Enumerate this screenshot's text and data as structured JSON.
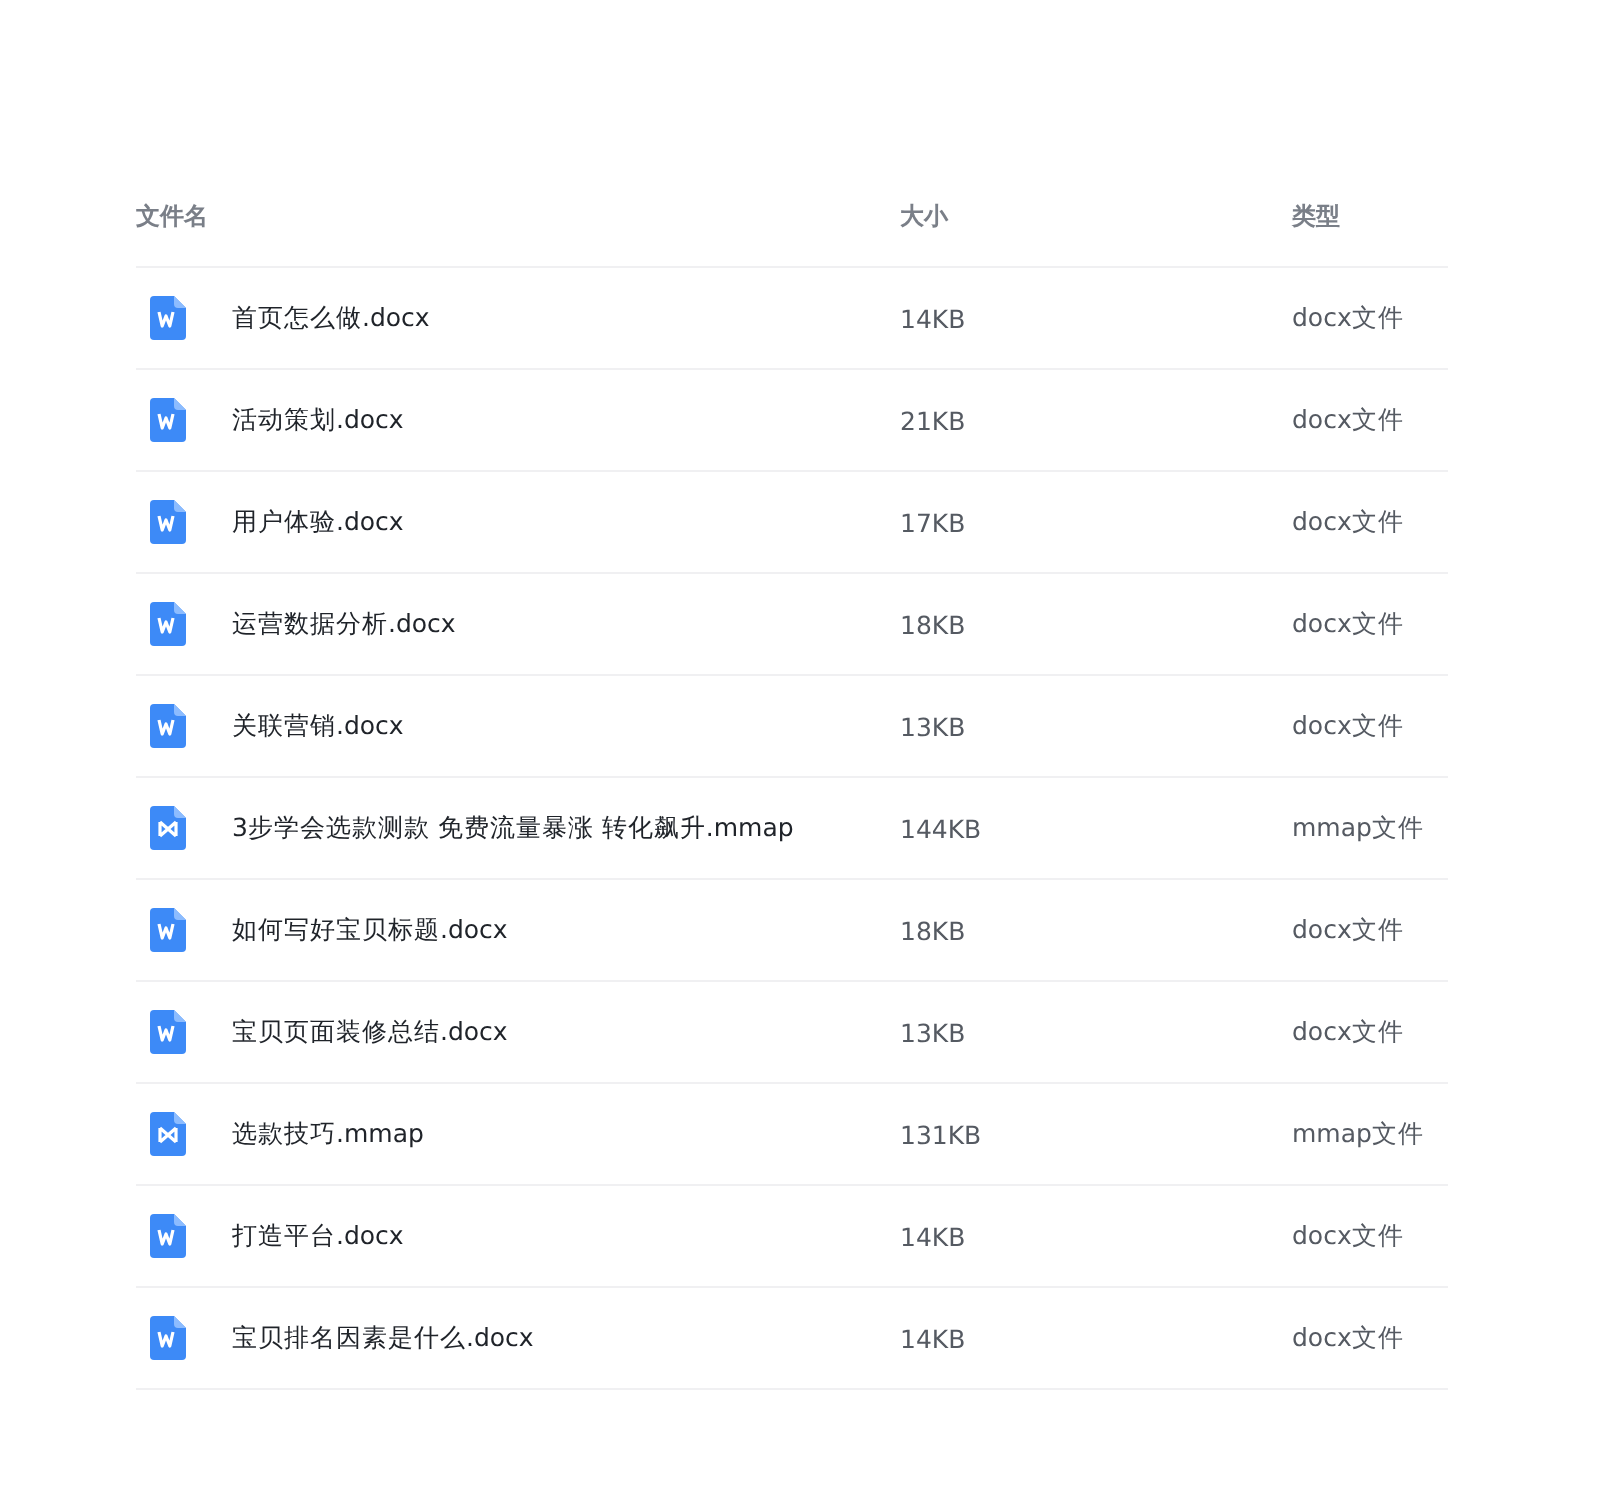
{
  "table": {
    "columns": [
      "文件名",
      "大小",
      "类型"
    ],
    "rows": [
      {
        "kind": "doc",
        "name": "首页怎么做.docx",
        "size": "14KB",
        "type": "docx文件"
      },
      {
        "kind": "doc",
        "name": "活动策划.docx",
        "size": "21KB",
        "type": "docx文件"
      },
      {
        "kind": "doc",
        "name": "用户体验.docx",
        "size": "17KB",
        "type": "docx文件"
      },
      {
        "kind": "doc",
        "name": "运营数据分析.docx",
        "size": "18KB",
        "type": "docx文件"
      },
      {
        "kind": "doc",
        "name": "关联营销.docx",
        "size": "13KB",
        "type": "docx文件"
      },
      {
        "kind": "mindmap",
        "name": "3步学会选款测款 免费流量暴涨 转化飙升.mmap",
        "size": "144KB",
        "type": "mmap文件"
      },
      {
        "kind": "doc",
        "name": "如何写好宝贝标题.docx",
        "size": "18KB",
        "type": "docx文件"
      },
      {
        "kind": "doc",
        "name": "宝贝页面装修总结.docx",
        "size": "13KB",
        "type": "docx文件"
      },
      {
        "kind": "mindmap",
        "name": "选款技巧.mmap",
        "size": "131KB",
        "type": "mmap文件"
      },
      {
        "kind": "doc",
        "name": "打造平台.docx",
        "size": "14KB",
        "type": "docx文件"
      },
      {
        "kind": "doc",
        "name": "宝贝排名因素是什么.docx",
        "size": "14KB",
        "type": "docx文件"
      }
    ]
  }
}
